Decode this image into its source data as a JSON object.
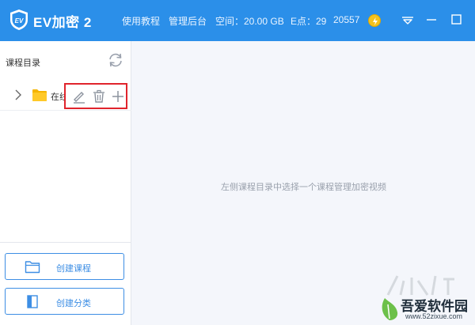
{
  "titlebar": {
    "app_title": "EV加密 2",
    "links": {
      "tutorial": "使用教程",
      "admin": "管理后台"
    },
    "space_text": "空间：20.00 GB",
    "e_points_text": "E点：29",
    "id_number": "20557",
    "colors": {
      "bar": "#2b8fe9",
      "coin": "#f4c21d"
    }
  },
  "sidebar": {
    "title": "课程目录",
    "tree": [
      {
        "label": "在线"
      }
    ],
    "buttons": {
      "create_course": "创建课程",
      "create_category": "创建分类"
    }
  },
  "main": {
    "empty_hint": "左侧课程目录中选择一个课程管理加密视频"
  },
  "watermark": {
    "name": "吾爱软件园",
    "url": "www.52zixue.com"
  }
}
